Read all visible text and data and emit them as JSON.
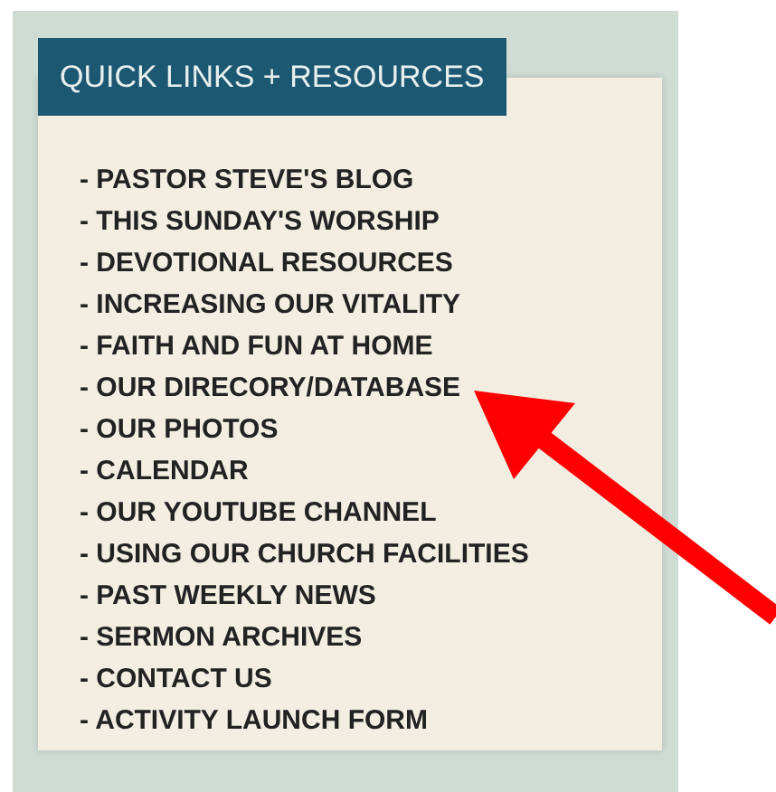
{
  "widget": {
    "title": "QUICK LINKS + RESOURCES",
    "links": [
      "- PASTOR STEVE'S BLOG",
      "- THIS SUNDAY'S WORSHIP",
      "- DEVOTIONAL RESOURCES",
      "- INCREASING OUR VITALITY",
      "- FAITH AND FUN AT HOME",
      "- OUR DIRECORY/DATABASE",
      "- OUR PHOTOS",
      "- CALENDAR",
      "- OUR YOUTUBE CHANNEL",
      "- USING OUR CHURCH FACILITIES",
      "- PAST WEEKLY NEWS",
      "- SERMON ARCHIVES",
      "- CONTACT US",
      "- ACTIVITY LAUNCH FORM"
    ]
  }
}
